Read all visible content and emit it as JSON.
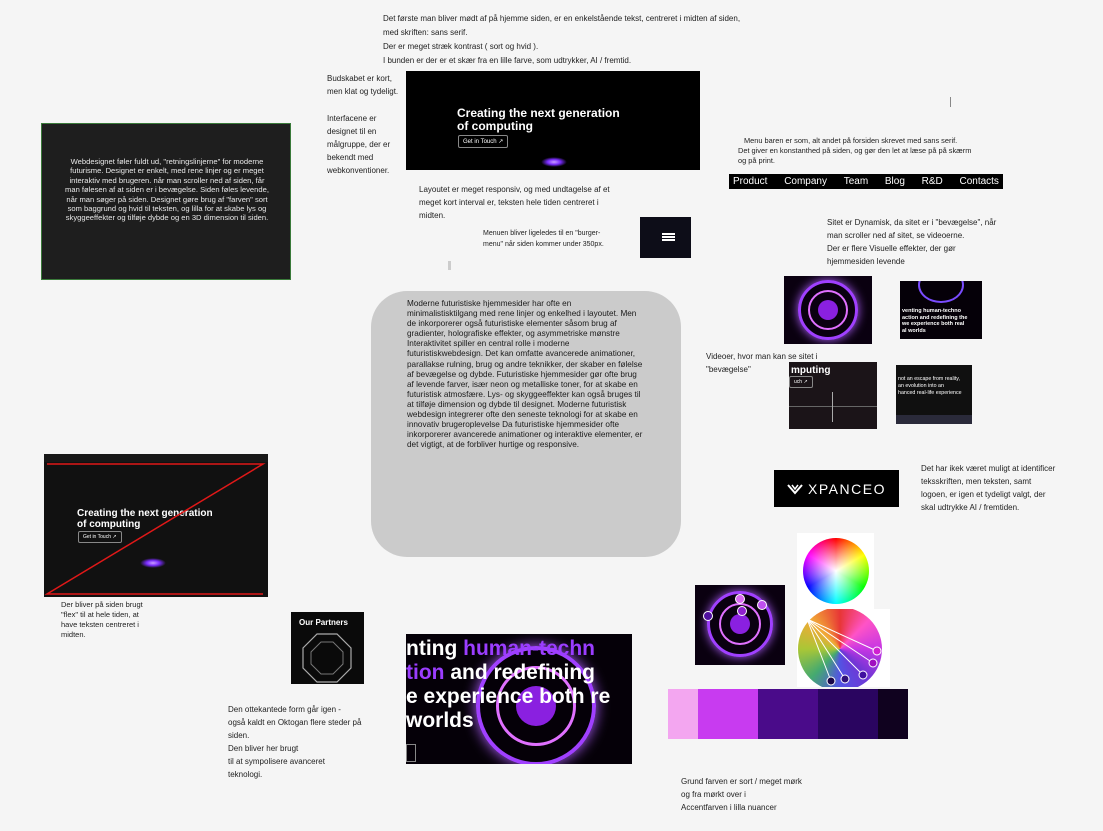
{
  "notes": {
    "intro": [
      "Det første man bliver mødt af på hjemme siden, er en enkelstående tekst, centreret i midten af siden,",
      "med skriften: sans serif.",
      "Der er meget stræk kontrast ( sort og hvid ).",
      "I bunden er der er et skær fra en lille farve, som udtrykker,  AI / fremtid."
    ],
    "budskab": [
      "Budskabet er kort,",
      "men klat og tydeligt."
    ],
    "interface": [
      "Interfacene er",
      "designet til en",
      "målgruppe, der er",
      "bekendt med",
      "webkonventioner."
    ],
    "layout": [
      "Layoutet er meget responsiv, og med undtagelse af et",
      "meget kort interval er, teksten hele tiden centreret i",
      "midten."
    ],
    "burger": [
      "Menuen bliver ligeledes til en \"burger-",
      "menu\" når siden kommer under 350px."
    ],
    "menu": [
      "Menu baren er som, alt andet på forsiden skrevet med sans serif.",
      "Det giver en konstanthed på siden, og gør den let at læse på på skærm",
      "og på print."
    ],
    "dynamic": [
      "Sitet er Dynamisk, da sitet er i \"bevægelse\", når",
      "man scroller ned af sitet, se videoerne.",
      "Der er flere Visuelle effekter, der gør",
      "hjemmesiden levende"
    ],
    "videos": [
      "Videoer, hvor man kan se sitet i",
      "\"bevægelse\""
    ],
    "font": [
      "Det har ikek været muligt at identificer",
      "teksskriften, men teksten, samt",
      "logoen, er igen et tydeligt valgt, der",
      "skal udtrykke AI / fremtiden."
    ],
    "flex": [
      "Der bliver på siden brugt",
      "\"flex\" til at hele tiden, at",
      "have teksten centreret i",
      "midten."
    ],
    "octagon": [
      "Den ottekantede form  går igen -",
      "også kaldt en Oktogan flere steder på",
      "siden.",
      "Den bliver her brugt",
      "til at sympolisere avanceret",
      "teknologi."
    ],
    "color": [
      "Grund farven er sort / meget mørk",
      "og fra mørkt over i",
      "Accentfarven i lilla nuancer"
    ]
  },
  "dark_box_text": "Webdesignet føler fuldt ud, \"retningslinjerne\" for moderne futurisme.  Designet er enkelt, med rene linjer og er meget interaktiv med brugeren. når man scroller ned af siden, får man følesen af at siden er i bevægelse. Siden føles levende, når man søger på siden. Designet gøre brug af \"farven\" sort som baggrund og hvid til teksten, og lilla for at skabe lys og skyggeeffekter og tilføje dybde og en 3D dimension til siden.",
  "bubble_text": "Moderne futuristiske hjemmesider har ofte en minimalistisktilgang med rene linjer og enkelhed i layoutet. Men de inkorporerer også futuristiske elementer såsom brug af gradienter, holografiske effekter, og asymmetriske mønstre Interaktivitet spiller en central rolle i moderne futuristiskwebdesign. Det kan omfatte avancerede animationer, parallakse rulning, brug  og andre teknikker, der skaber en følelse af bevægelse og dybde. Futuristiske hjemmesider gør ofte brug af levende farver, især neon og metalliske toner, for at skabe en futuristisk atmosfære. Lys- og skyggeeffekter kan også bruges til at tilføje dimension og dybde til designet. Moderne futuristisk webdesign integrerer ofte den seneste teknologi for at skabe en innovativ brugeroplevelse Da futuristiske hjemmesider ofte inkorporerer avancerede animationer og interaktive elementer, er det vigtigt, at de forbliver hurtige og responsive.",
  "hero": {
    "title_line1": "Creating the next generation",
    "title_line2": "of computing",
    "cta": "Get in Touch ↗"
  },
  "menu_items": [
    "Product",
    "Company",
    "Team",
    "Blog",
    "R&D",
    "Contacts"
  ],
  "logo": "XPANCEO",
  "partners": "Our Partners",
  "big_text": {
    "l1a": "nting ",
    "l1b": "human-techn",
    "l2a": "tion",
    "l2b": " and redefining",
    "l3": "e experience both re",
    "l4": "worlds"
  },
  "thumb_texts": {
    "t1": "venting human-techno",
    "t1b": "action and redefining the",
    "t1c": "we experience both real",
    "t1d": "al worlds",
    "t2": "mputing",
    "t2b": "uch ↗",
    "t3a": "not an escape from reality,",
    "t3b": "an evolution into an",
    "t3c": "hanced real-life experience"
  },
  "palette": [
    "#f3a6f0",
    "#c83bf0",
    "#4a0b8a",
    "#2a0560",
    "#10021f"
  ],
  "colors": {
    "accent": "#9b3dff",
    "bg_dark": "#000000",
    "canvas": "#f5f5f5"
  }
}
